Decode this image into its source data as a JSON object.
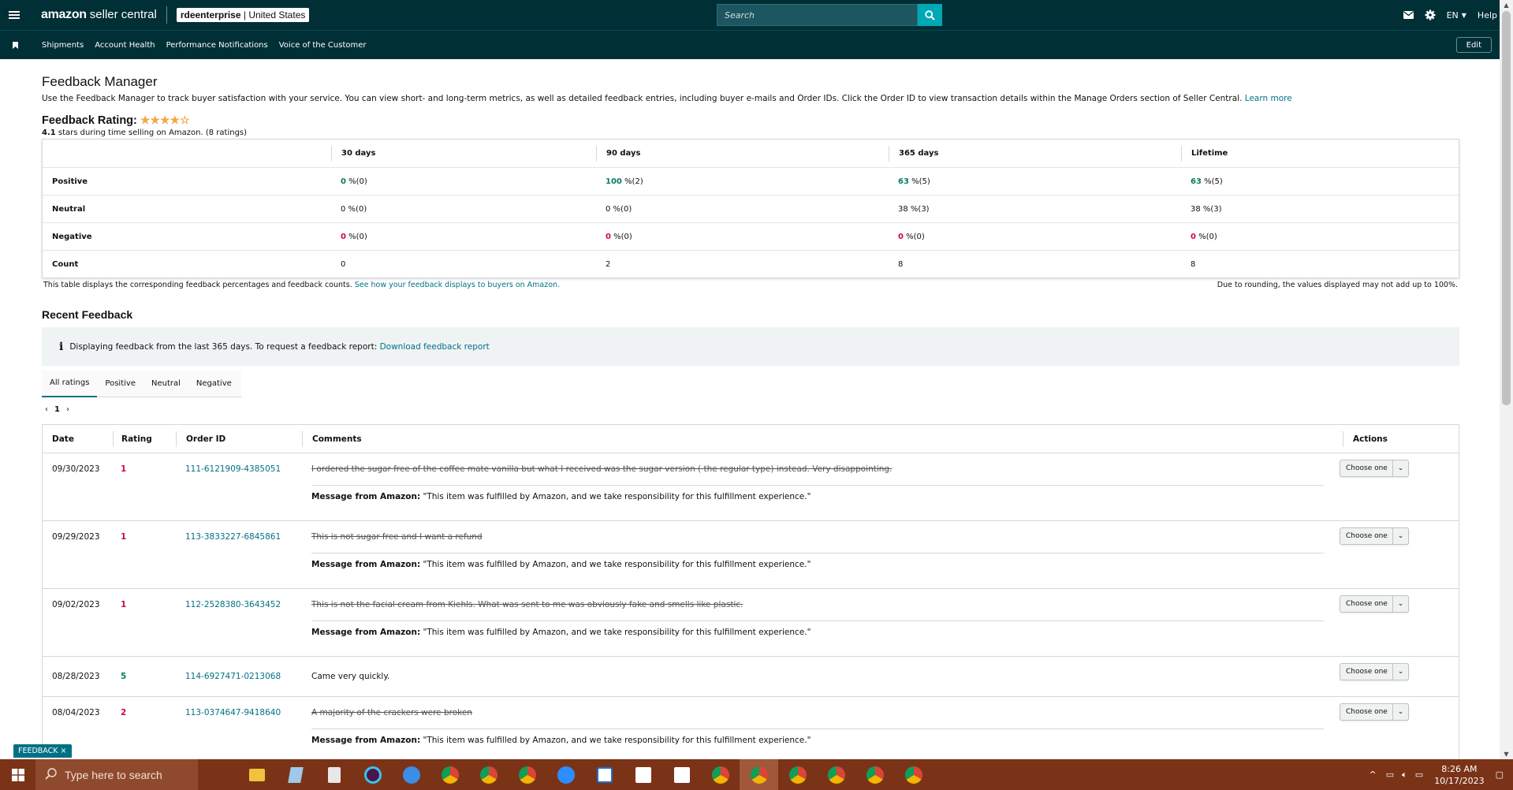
{
  "header": {
    "logo_bold": "amazon",
    "logo_rest": "seller central",
    "store_name": "rdeenterprise",
    "store_region": "| United States",
    "search_placeholder": "Search",
    "language": "EN",
    "help": "Help"
  },
  "nav": {
    "items": [
      "Shipments",
      "Account Health",
      "Performance Notifications",
      "Voice of the Customer"
    ],
    "edit": "Edit"
  },
  "page": {
    "title": "Feedback Manager",
    "description": "Use the Feedback Manager to track buyer satisfaction with your service. You can view short- and long-term metrics, as well as detailed feedback entries, including buyer e-mails and Order IDs. Click the Order ID to view transaction details within the Manage Orders section of Seller Central.",
    "learn_more": "Learn more",
    "rating_label": "Feedback Rating:",
    "stars_value": 4.1,
    "stars_text_num": "4.1",
    "stars_text_rest": "stars during time selling on Amazon. (8 ratings)"
  },
  "summary": {
    "columns": [
      "30 days",
      "90 days",
      "365 days",
      "Lifetime"
    ],
    "rows": [
      {
        "label": "Positive",
        "cells": [
          {
            "num": "0",
            "rest": " %(0)"
          },
          {
            "num": "100",
            "rest": " %(2)"
          },
          {
            "num": "63",
            "rest": " %(5)"
          },
          {
            "num": "63",
            "rest": " %(5)"
          }
        ]
      },
      {
        "label": "Neutral",
        "cells": [
          {
            "num": "0",
            "rest": " %(0)"
          },
          {
            "num": "0",
            "rest": " %(0)"
          },
          {
            "num": "38",
            "rest": " %(3)"
          },
          {
            "num": "38",
            "rest": " %(3)"
          }
        ]
      },
      {
        "label": "Negative",
        "cells": [
          {
            "num": "0",
            "rest": " %(0)"
          },
          {
            "num": "0",
            "rest": " %(0)"
          },
          {
            "num": "0",
            "rest": " %(0)"
          },
          {
            "num": "0",
            "rest": " %(0)"
          }
        ]
      },
      {
        "label": "Count",
        "cells": [
          {
            "num": "0",
            "rest": ""
          },
          {
            "num": "2",
            "rest": ""
          },
          {
            "num": "8",
            "rest": ""
          },
          {
            "num": "8",
            "rest": ""
          }
        ]
      }
    ],
    "footnote": "This table displays the corresponding feedback percentages and feedback counts.",
    "footnote_link": "See how your feedback displays to buyers on Amazon.",
    "rounding_note": "Due to rounding, the values displayed may not add up to 100%."
  },
  "recent": {
    "title": "Recent Feedback",
    "alert_text": "Displaying feedback from the last 365 days. To request a feedback report:",
    "alert_link": "Download feedback report",
    "tabs": [
      "All ratings",
      "Positive",
      "Neutral",
      "Negative"
    ],
    "page": "1",
    "columns": {
      "date": "Date",
      "rating": "Rating",
      "order": "Order ID",
      "comments": "Comments",
      "actions": "Actions"
    },
    "msg_label": "Message from Amazon:",
    "action_label": "Choose one",
    "rows": [
      {
        "date": "09/30/2023",
        "rating": "1",
        "order_id": "111-6121909-4385051",
        "comment": "I ordered the sugar free of the coffee mate vanilla but what I received was the sugar version ( the regular type) instead. Very disappointing.",
        "struck": true,
        "message": "\"This item was fulfilled by Amazon, and we take responsibility for this fulfillment experience.\""
      },
      {
        "date": "09/29/2023",
        "rating": "1",
        "order_id": "113-3833227-6845861",
        "comment": "This is not sugar free and I want a refund",
        "struck": true,
        "message": "\"This item was fulfilled by Amazon, and we take responsibility for this fulfillment experience.\""
      },
      {
        "date": "09/02/2023",
        "rating": "1",
        "order_id": "112-2528380-3643452",
        "comment": "This is not the facial cream from Kiehls. What was sent to me was obviously fake and smells like plastic.",
        "struck": true,
        "message": "\"This item was fulfilled by Amazon, and we take responsibility for this fulfillment experience.\""
      },
      {
        "date": "08/28/2023",
        "rating": "5",
        "order_id": "114-6927471-0213068",
        "comment": "Came very quickly.",
        "struck": false,
        "message": ""
      },
      {
        "date": "08/04/2023",
        "rating": "2",
        "order_id": "113-0374647-9418640",
        "comment": "A majority of the crackers were broken",
        "struck": true,
        "message": "\"This item was fulfilled by Amazon, and we take responsibility for this fulfillment experience.\""
      }
    ]
  },
  "feedback_tab": "FEEDBACK",
  "taskbar": {
    "search_placeholder": "Type here to search",
    "time": "8:26 AM",
    "date": "10/17/2023"
  },
  "colors": {
    "header_bg": "#002f36",
    "link": "#007185",
    "positive": "#067d62",
    "negative": "#cc0c39",
    "star": "#f3a847",
    "taskbar": "#7b3318"
  }
}
